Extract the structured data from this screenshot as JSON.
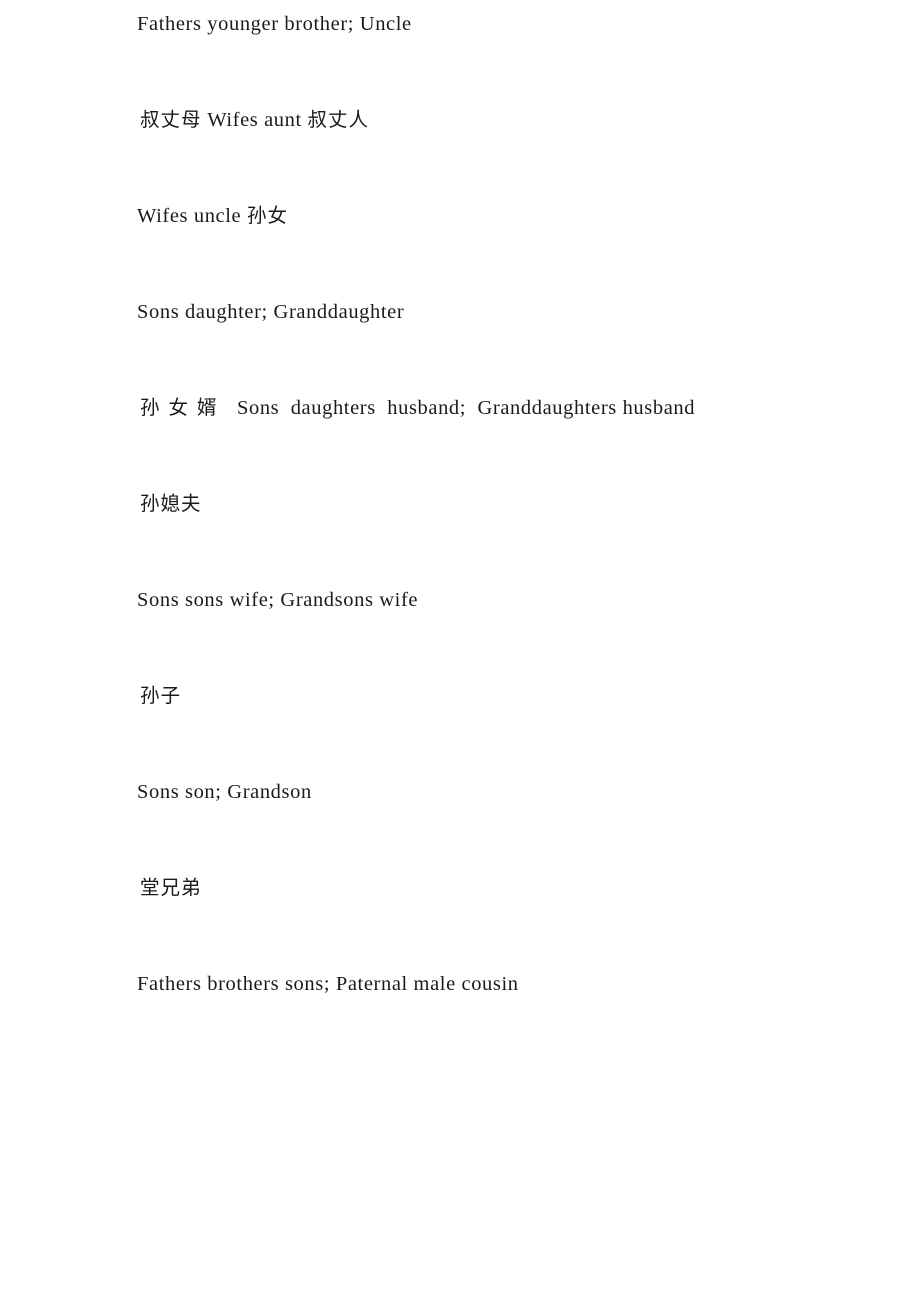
{
  "document": {
    "background_color": "#ffffff",
    "text_color": "#1a1a1a",
    "paragraphs": [
      {
        "id": "p1",
        "text": "Fathers younger brother; Uncle",
        "script": "latin",
        "justified": false
      },
      {
        "id": "p2",
        "text": "叔丈母 Wifes aunt 叔丈人",
        "script": "mixed",
        "justified": false
      },
      {
        "id": "p3",
        "text": "Wifes uncle 孙女",
        "script": "mixed",
        "justified": false
      },
      {
        "id": "p4",
        "text": "Sons daughter; Granddaughter",
        "script": "latin",
        "justified": false
      },
      {
        "id": "p5",
        "text": "孙女婿  Sons  daughters  husband;  Granddaughters husband",
        "script": "mixed",
        "justified": true
      },
      {
        "id": "p6",
        "text": "孙媳夫",
        "script": "cjk",
        "justified": false
      },
      {
        "id": "p7",
        "text": "Sons sons wife; Grandsons wife",
        "script": "latin",
        "justified": false
      },
      {
        "id": "p8",
        "text": "孙子",
        "script": "cjk",
        "justified": false
      },
      {
        "id": "p9",
        "text": "Sons son; Grandson",
        "script": "latin",
        "justified": false
      },
      {
        "id": "p10",
        "text": "堂兄弟",
        "script": "cjk",
        "justified": false
      },
      {
        "id": "p11",
        "text": "Fathers brothers sons; Paternal male cousin",
        "script": "latin",
        "justified": false
      }
    ]
  }
}
